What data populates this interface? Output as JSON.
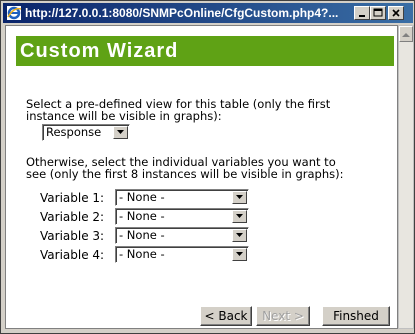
{
  "window": {
    "title": "http://127.0.0.1:8080/SNMPcOnline/CfgCustom.php4?...",
    "title_bar_color": "#0a246a"
  },
  "wizard": {
    "title": "Custom Wizard",
    "banner_color": "#5fa215",
    "predefined_text_line1": "Select a pre-defined view for this table (only the first",
    "predefined_text_line2": "instance will be visible in graphs):",
    "predefined_select": {
      "value": "Response"
    },
    "individual_text_line1": "Otherwise, select the individual variables you want to",
    "individual_text_line2": "see (only the first 8 instances will be visible in graphs):",
    "variables": [
      {
        "label": "Variable 1:",
        "value": "- None -"
      },
      {
        "label": "Variable 2:",
        "value": "- None -"
      },
      {
        "label": "Variable 3:",
        "value": "- None -"
      },
      {
        "label": "Variable 4:",
        "value": "- None -"
      }
    ],
    "buttons": {
      "back": "< Back",
      "next": "Next >",
      "finish": "Finshed"
    }
  }
}
